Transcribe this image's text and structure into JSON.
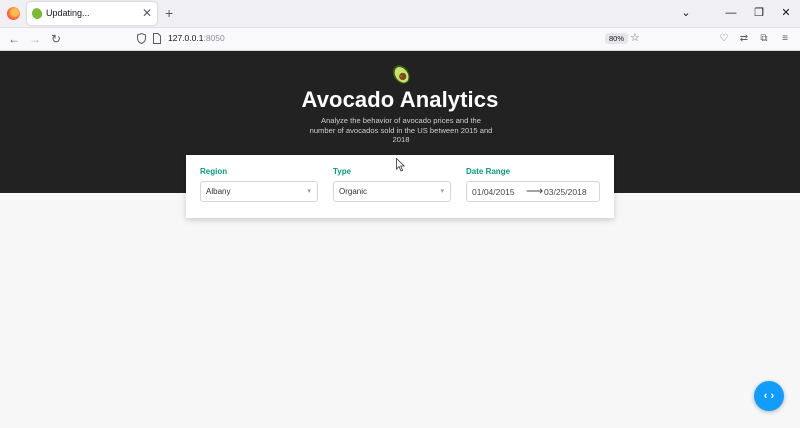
{
  "browser": {
    "tab": {
      "title": "Updating...",
      "close_glyph": "✕"
    },
    "new_tab_glyph": "+",
    "window_controls": {
      "list": "⌄",
      "minimize": "—",
      "restore": "❐",
      "close": "✕"
    },
    "nav": {
      "back": "←",
      "forward": "→",
      "reload": "↻"
    },
    "url": {
      "host": "127.0.0.1",
      "port": ":8050"
    },
    "zoom": "80%",
    "bookmark_glyph": "☆",
    "toolbar_glyphs": {
      "pocket": "♡",
      "extensions": "⧉",
      "translate": "⇄",
      "menu": "≡"
    }
  },
  "header": {
    "title": "Avocado Analytics",
    "subtitle_line1": "Analyze the behavior of avocado prices and the",
    "subtitle_line2": "number of avocados sold in the US between 2015 and",
    "subtitle_line3": "2018"
  },
  "filters": {
    "region": {
      "label": "Region",
      "value": "Albany"
    },
    "type": {
      "label": "Type",
      "value": "Organic"
    },
    "date_range": {
      "label": "Date Range",
      "start": "01/04/2015",
      "arrow": "⟶",
      "end": "03/25/2018"
    }
  },
  "debug_button": {
    "glyph": "‹ ›"
  },
  "colors": {
    "header_bg": "#222222",
    "label_accent": "#079a82",
    "debug_button": "#119dff"
  },
  "icons": [
    "firefox-icon",
    "avocado-favicon",
    "shield-icon",
    "page-icon",
    "star-icon",
    "avocado-logo-icon",
    "cursor-icon",
    "code-icon"
  ]
}
